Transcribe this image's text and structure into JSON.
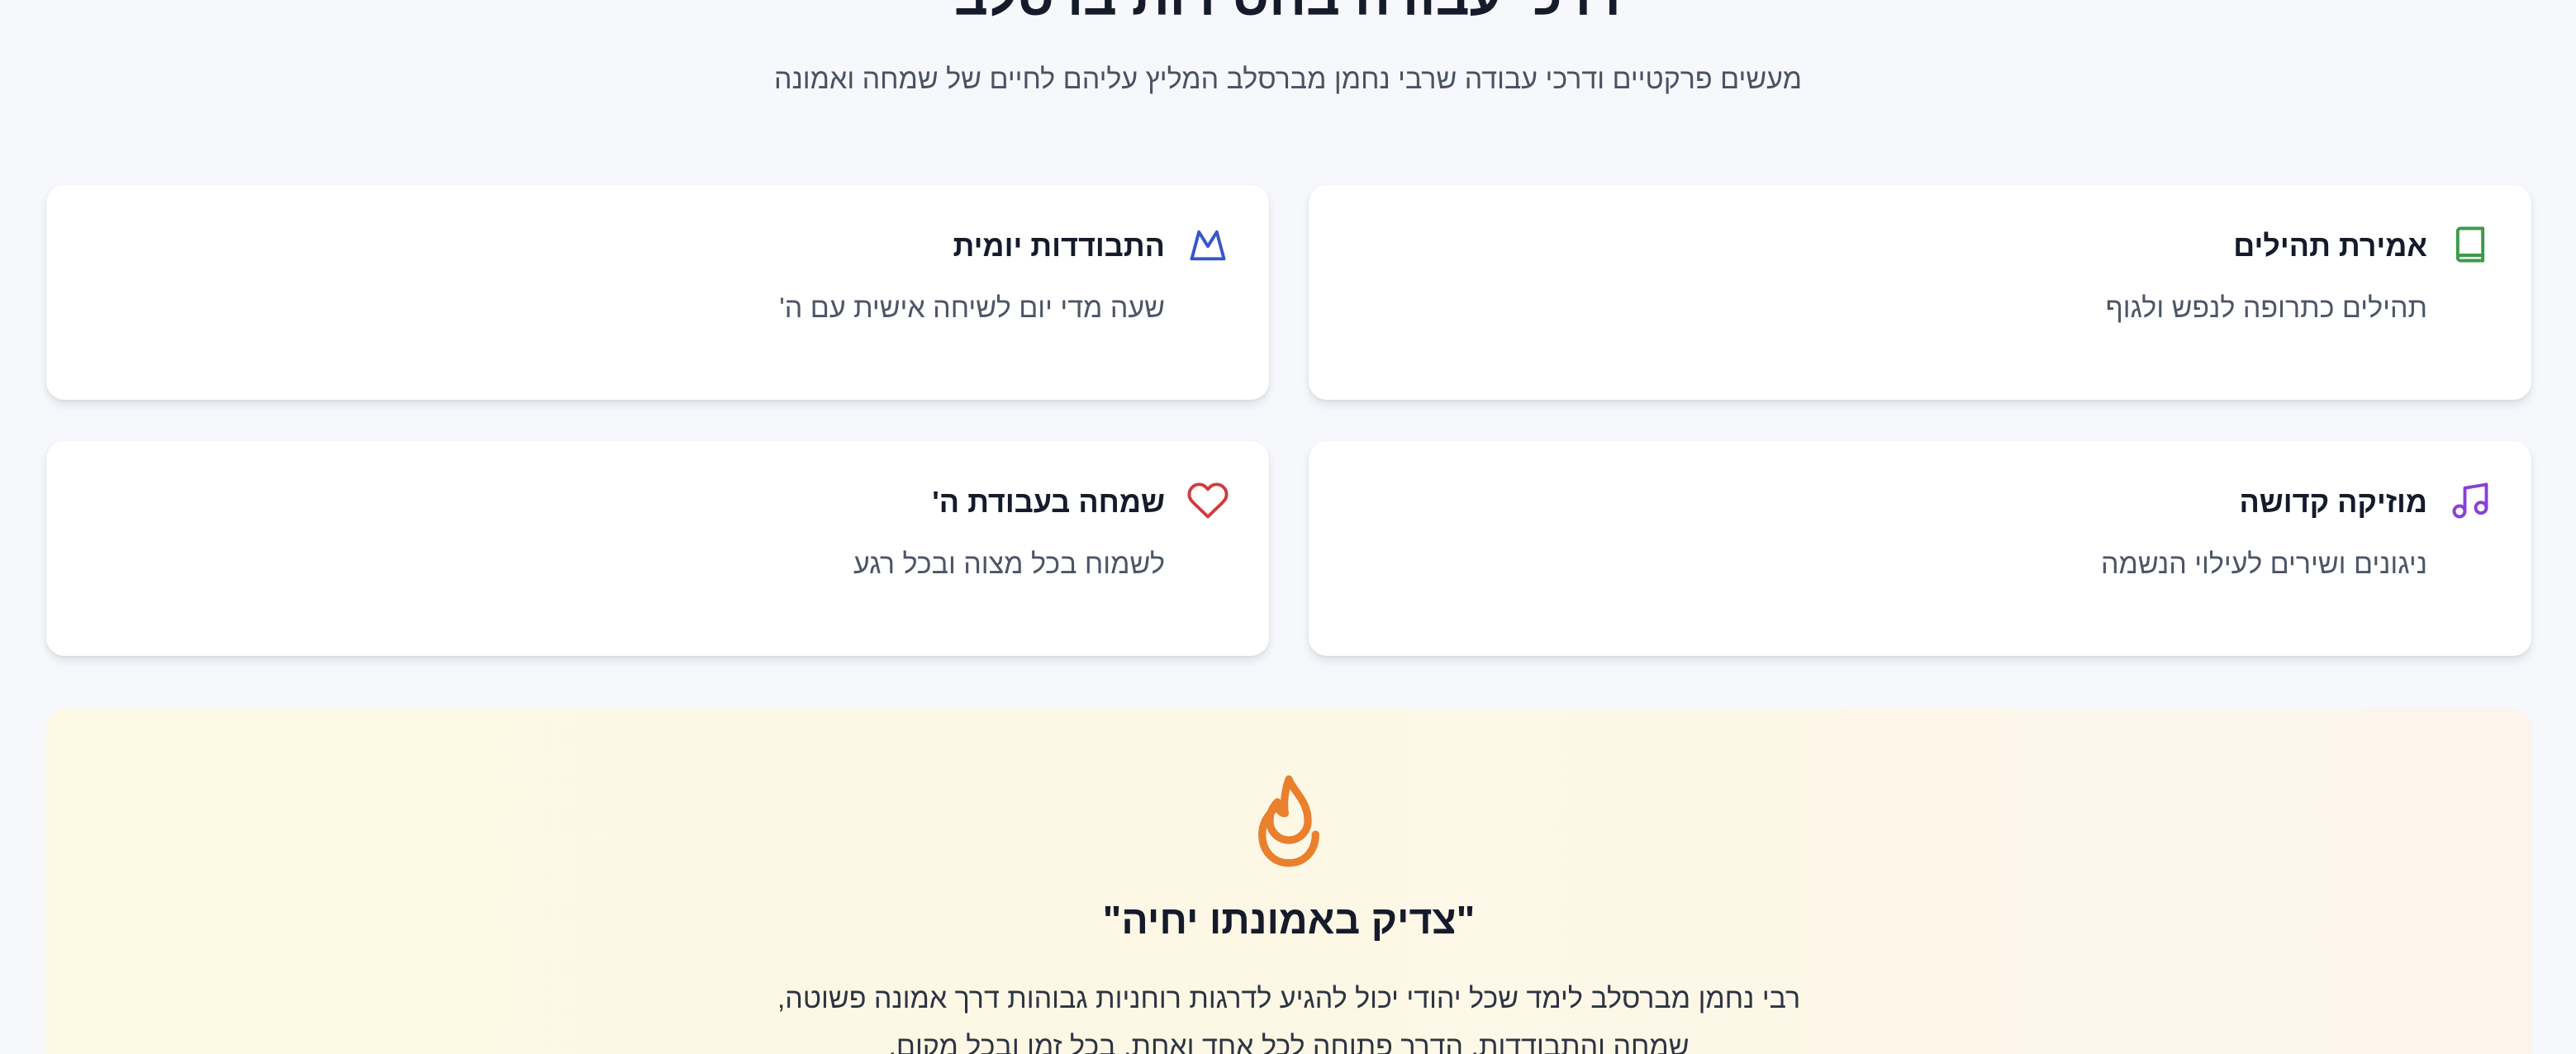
{
  "header": {
    "title": "דרכי עבודה בחסידות ברסלב",
    "subtitle": "מעשים פרקטיים ודרכי עבודה שרבי נחמן מברסלב המליץ עליהם לחיים של שמחה ואמונה"
  },
  "cards": [
    {
      "icon": "book-icon",
      "icon_color": "#3c9a4a",
      "title": "אמירת תהילים",
      "text": "תהילים כתרופה לנפש ולגוף"
    },
    {
      "icon": "mountain-icon",
      "icon_color": "#3557c8",
      "title": "התבודדות יומית",
      "text": "שעה מדי יום לשיחה אישית עם ה'"
    },
    {
      "icon": "music-icon",
      "icon_color": "#8a3fd6",
      "title": "מוזיקה קדושה",
      "text": "ניגונים ושירים לעילוי הנשמה"
    },
    {
      "icon": "heart-icon",
      "icon_color": "#d23b3b",
      "title": "שמחה בעבודת ה'",
      "text": "לשמוח בכל מצוה ובכל רגע"
    }
  ],
  "quote": {
    "icon": "flame-icon",
    "icon_color": "#ea7f2d",
    "title": "\"צדיק באמונתו יחיה\"",
    "text": "רבי נחמן מברסלב לימד שכל יהודי יכול להגיע לדרגות רוחניות גבוהות דרך אמונה פשוטה, שמחה והתבודדות. הדרך פתוחה לכל אחד ואחת, בכל זמן ובכל מקום."
  },
  "colors": {
    "background": "#f6f8fc",
    "card_background": "#ffffff",
    "quote_background": "#fdf8e6"
  }
}
